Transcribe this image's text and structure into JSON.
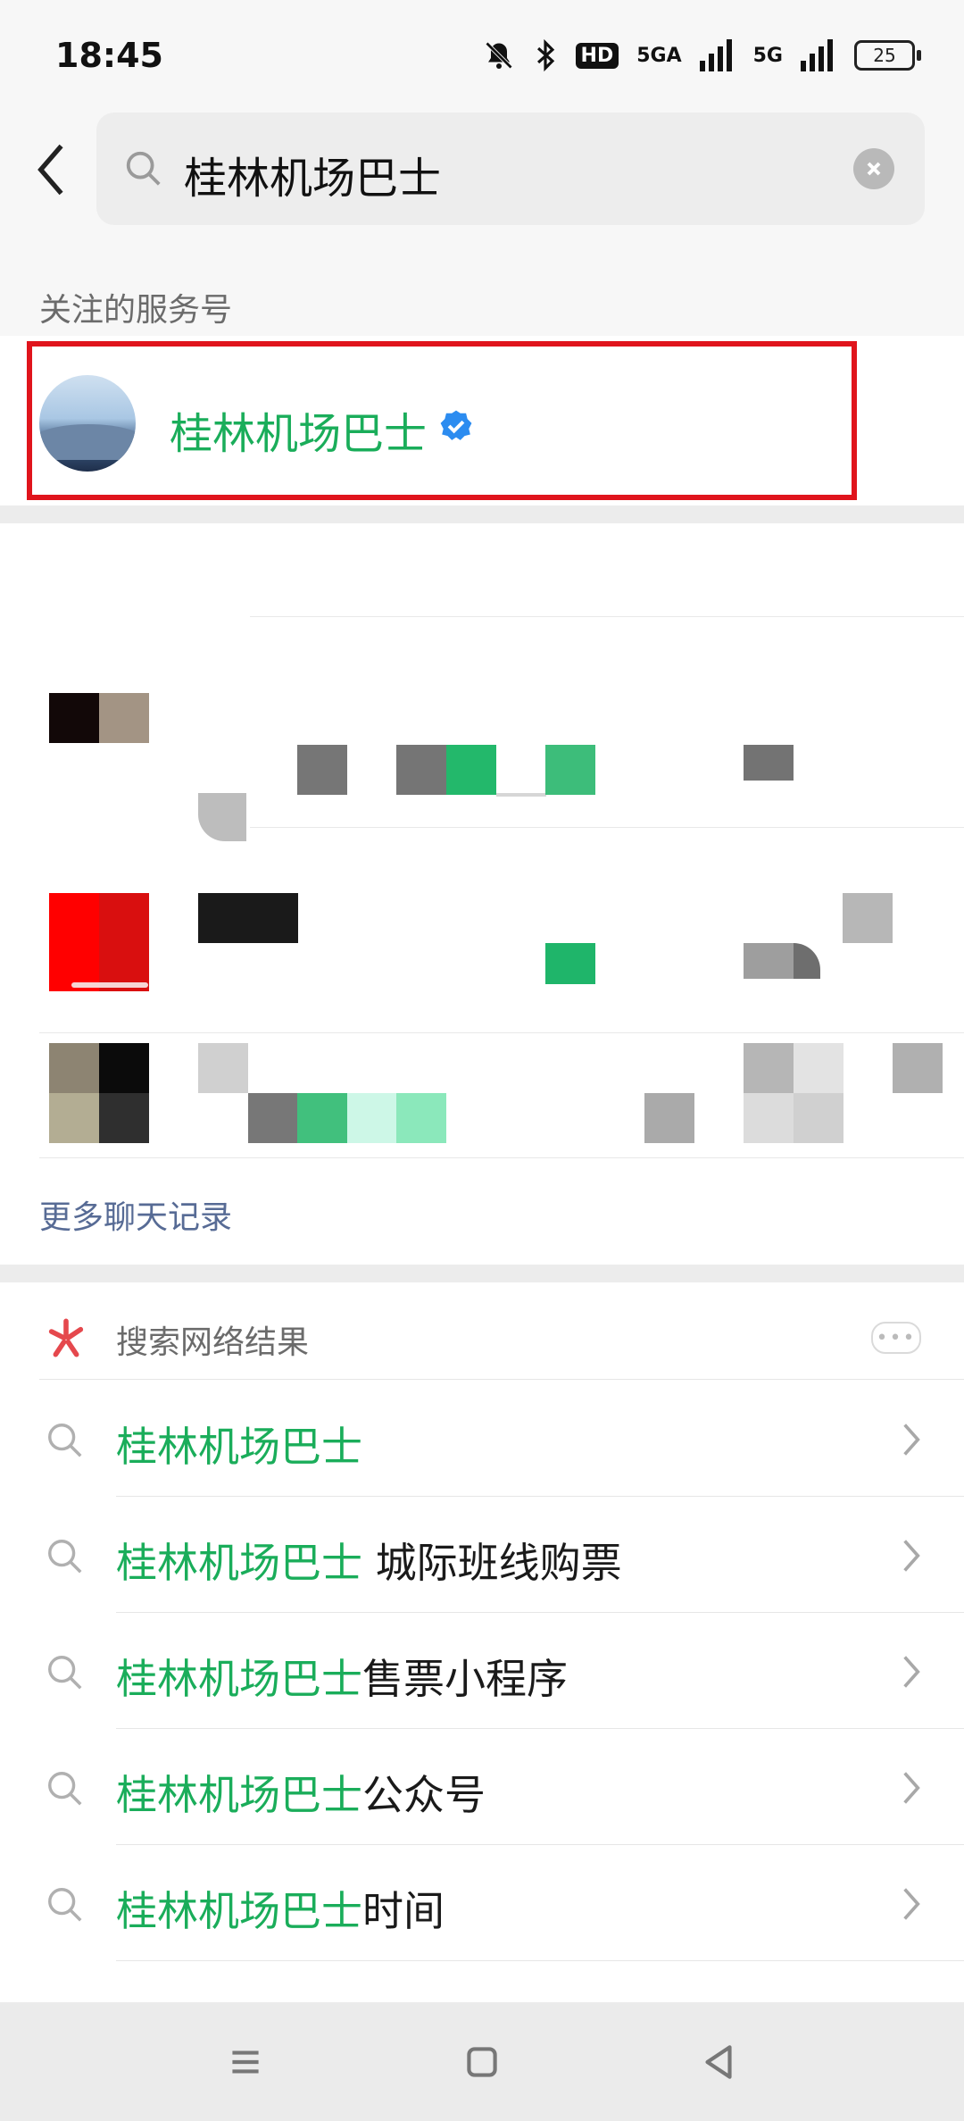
{
  "status_bar": {
    "time": "18:45",
    "hd_label": "HD",
    "signal1_label": "5GA",
    "signal2_label": "5G",
    "battery": "25",
    "icons": [
      "bell-off-icon",
      "bluetooth-icon",
      "signal-icon",
      "battery-icon"
    ]
  },
  "search": {
    "query": "桂林机场巴士"
  },
  "followed_section": {
    "label": "关注的服务号",
    "account": {
      "name": "桂林机场巴士",
      "verified": true
    }
  },
  "chat_records": {
    "more_label": "更多聊天记录"
  },
  "web_results": {
    "header": "搜索网络结果",
    "items": [
      {
        "highlight": "桂林机场巴士",
        "rest": ""
      },
      {
        "highlight": "桂林机场巴士",
        "rest": " 城际班线购票"
      },
      {
        "highlight": "桂林机场巴士",
        "rest": "售票小程序"
      },
      {
        "highlight": "桂林机场巴士",
        "rest": "公众号"
      },
      {
        "highlight": "桂林机场巴士",
        "rest": "时间"
      }
    ]
  },
  "colors": {
    "accent_green": "#1aad5a",
    "highlight_red": "#e0141c",
    "link_blue": "#576b95"
  }
}
